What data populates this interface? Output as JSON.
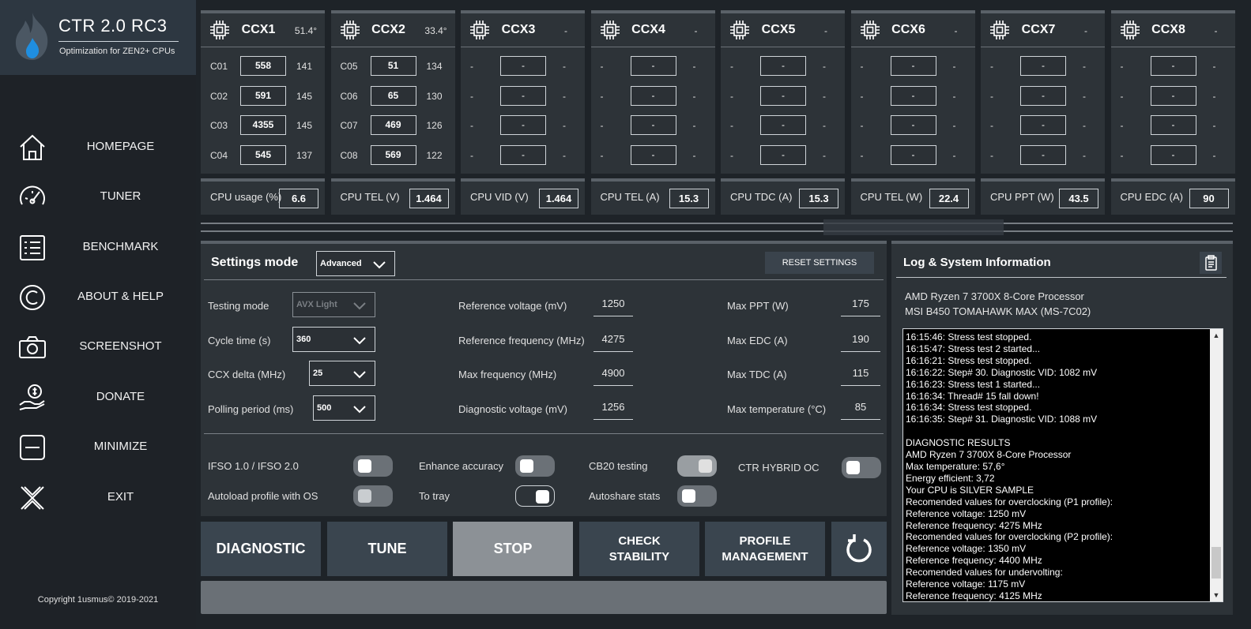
{
  "app": {
    "title": "CTR 2.0 RC3",
    "subtitle": "Optimization for ZEN2+ CPUs",
    "copyright": "Copyright 1usmus© 2019-2021"
  },
  "nav": [
    {
      "label": "HOMEPAGE",
      "icon": "home-icon"
    },
    {
      "label": "TUNER",
      "icon": "gauge-icon"
    },
    {
      "label": "BENCHMARK",
      "icon": "checklist-icon"
    },
    {
      "label": "ABOUT & HELP",
      "icon": "copyright-icon"
    },
    {
      "label": "SCREENSHOT",
      "icon": "camera-icon"
    },
    {
      "label": "DONATE",
      "icon": "donate-icon"
    },
    {
      "label": "MINIMIZE",
      "icon": "minimize-icon"
    },
    {
      "label": "EXIT",
      "icon": "close-icon"
    }
  ],
  "ccx": [
    {
      "name": "CCX1",
      "temp": "51.4°",
      "cores": [
        {
          "label": "C01",
          "freq": "558",
          "val": "141"
        },
        {
          "label": "C02",
          "freq": "591",
          "val": "145"
        },
        {
          "label": "C03",
          "freq": "4355",
          "val": "145"
        },
        {
          "label": "C04",
          "freq": "545",
          "val": "137"
        }
      ]
    },
    {
      "name": "CCX2",
      "temp": "33.4°",
      "cores": [
        {
          "label": "C05",
          "freq": "51",
          "val": "134"
        },
        {
          "label": "C06",
          "freq": "65",
          "val": "130"
        },
        {
          "label": "C07",
          "freq": "469",
          "val": "126"
        },
        {
          "label": "C08",
          "freq": "569",
          "val": "122"
        }
      ]
    },
    {
      "name": "CCX3",
      "temp": "-",
      "cores": [
        {
          "label": "-",
          "freq": "-",
          "val": "-"
        },
        {
          "label": "-",
          "freq": "-",
          "val": "-"
        },
        {
          "label": "-",
          "freq": "-",
          "val": "-"
        },
        {
          "label": "-",
          "freq": "-",
          "val": "-"
        }
      ]
    },
    {
      "name": "CCX4",
      "temp": "-",
      "cores": [
        {
          "label": "-",
          "freq": "-",
          "val": "-"
        },
        {
          "label": "-",
          "freq": "-",
          "val": "-"
        },
        {
          "label": "-",
          "freq": "-",
          "val": "-"
        },
        {
          "label": "-",
          "freq": "-",
          "val": "-"
        }
      ]
    },
    {
      "name": "CCX5",
      "temp": "-",
      "cores": [
        {
          "label": "-",
          "freq": "-",
          "val": "-"
        },
        {
          "label": "-",
          "freq": "-",
          "val": "-"
        },
        {
          "label": "-",
          "freq": "-",
          "val": "-"
        },
        {
          "label": "-",
          "freq": "-",
          "val": "-"
        }
      ]
    },
    {
      "name": "CCX6",
      "temp": "-",
      "cores": [
        {
          "label": "-",
          "freq": "-",
          "val": "-"
        },
        {
          "label": "-",
          "freq": "-",
          "val": "-"
        },
        {
          "label": "-",
          "freq": "-",
          "val": "-"
        },
        {
          "label": "-",
          "freq": "-",
          "val": "-"
        }
      ]
    },
    {
      "name": "CCX7",
      "temp": "-",
      "cores": [
        {
          "label": "-",
          "freq": "-",
          "val": "-"
        },
        {
          "label": "-",
          "freq": "-",
          "val": "-"
        },
        {
          "label": "-",
          "freq": "-",
          "val": "-"
        },
        {
          "label": "-",
          "freq": "-",
          "val": "-"
        }
      ]
    },
    {
      "name": "CCX8",
      "temp": "-",
      "cores": [
        {
          "label": "-",
          "freq": "-",
          "val": "-"
        },
        {
          "label": "-",
          "freq": "-",
          "val": "-"
        },
        {
          "label": "-",
          "freq": "-",
          "val": "-"
        },
        {
          "label": "-",
          "freq": "-",
          "val": "-"
        }
      ]
    }
  ],
  "stats": [
    {
      "label": "CPU usage (%)",
      "value": "6.6"
    },
    {
      "label": "CPU TEL (V)",
      "value": "1.464"
    },
    {
      "label": "CPU VID (V)",
      "value": "1.464"
    },
    {
      "label": "CPU TEL (A)",
      "value": "15.3"
    },
    {
      "label": "CPU TDC (A)",
      "value": "15.3"
    },
    {
      "label": "CPU TEL (W)",
      "value": "22.4"
    },
    {
      "label": "CPU PPT (W)",
      "value": "43.5"
    },
    {
      "label": "CPU EDC (A)",
      "value": "90"
    }
  ],
  "settings": {
    "title": "Settings mode",
    "mode": "Advanced",
    "reset_label": "RESET SETTINGS",
    "testing_mode": {
      "label": "Testing mode",
      "value": "AVX Light"
    },
    "cycle_time": {
      "label": "Cycle time (s)",
      "value": "360"
    },
    "ccx_delta": {
      "label": "CCX delta (MHz)",
      "value": "25"
    },
    "polling": {
      "label": "Polling period (ms)",
      "value": "500"
    },
    "mid": [
      {
        "label": "Reference voltage (mV)",
        "value": "1250"
      },
      {
        "label": "Reference frequency (MHz)",
        "value": "4275"
      },
      {
        "label": "Max frequency (MHz)",
        "value": "4900"
      },
      {
        "label": "Diagnostic voltage (mV)",
        "value": "1256"
      }
    ],
    "right": [
      {
        "label": "Max PPT (W)",
        "value": "175"
      },
      {
        "label": "Max EDC (A)",
        "value": "190"
      },
      {
        "label": "Max TDC (A)",
        "value": "115"
      },
      {
        "label": "Max temperature (°C)",
        "value": "85"
      }
    ],
    "toggles": [
      {
        "label": "IFSO 1.0 / IFSO 2.0",
        "state": "off"
      },
      {
        "label": "Enhance accuracy",
        "state": "off"
      },
      {
        "label": "CB20 testing",
        "state": "grey-on"
      },
      {
        "label": "CTR HYBRID OC",
        "state": "off"
      },
      {
        "label": "Autoload profile with OS",
        "state": "off"
      },
      {
        "label": "To tray",
        "state": "on"
      },
      {
        "label": "Autoshare stats",
        "state": "off"
      }
    ]
  },
  "actions": [
    {
      "label": "DIAGNOSTIC"
    },
    {
      "label": "TUNE"
    },
    {
      "label": "STOP"
    },
    {
      "label": "CHECK\nSTABILITY"
    },
    {
      "label": "PROFILE\nMANAGEMENT"
    }
  ],
  "log": {
    "title": "Log & System Information",
    "cpu": "AMD Ryzen 7 3700X 8-Core Processor",
    "board": "MSI B450 TOMAHAWK MAX (MS-7C02)",
    "lines": [
      "16:15:46: Stress test stopped.",
      "16:15:47: Stress test 2 started...",
      "16:16:21: Stress test stopped.",
      "16:16:22: Step# 30. Diagnostic VID: 1082 mV",
      "16:16:23: Stress test 1 started...",
      "16:16:34: Thread# 15 fall down!",
      "16:16:34: Stress test stopped.",
      "16:16:35: Step# 31. Diagnostic VID: 1088 mV",
      "",
      "DIAGNOSTIC RESULTS",
      "AMD Ryzen 7 3700X 8-Core Processor",
      "Max temperature: 57,6°",
      "Energy efficient: 3,72",
      "Your CPU is SILVER SAMPLE",
      "Recomended values for overclocking (P1 profile):",
      "Reference voltage: 1250 mV",
      "Reference frequency: 4275 MHz",
      "Recomended values for overclocking (P2 profile):",
      "Reference voltage: 1350 mV",
      "Reference frequency: 4400 MHz",
      "Recomended values for undervolting:",
      "Reference voltage: 1175 mV",
      "Reference frequency: 4125 MHz"
    ]
  }
}
